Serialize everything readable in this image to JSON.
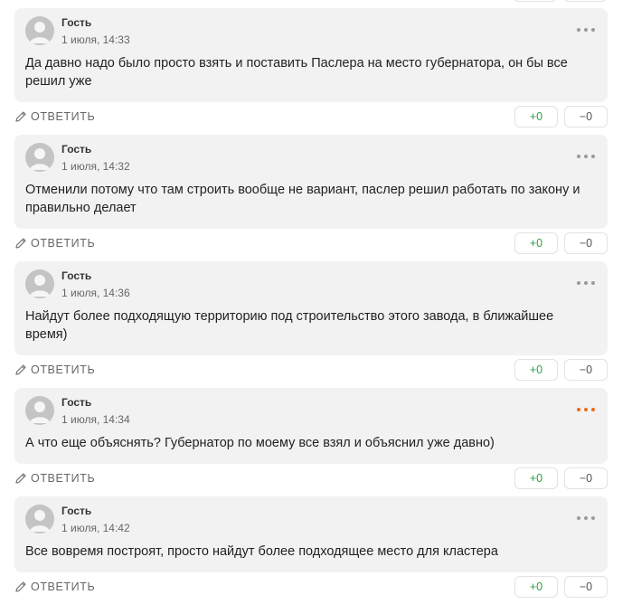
{
  "comments": [
    {
      "author": "Гость",
      "date": "1 июля, 14:33",
      "text": "Да давно надо было просто взять и поставить Паслера на место губернатора, он бы все решил уже",
      "reply_label": "ОТВЕТИТЬ",
      "likes": "+0",
      "dislikes": "−0",
      "menu_active": false
    },
    {
      "author": "Гость",
      "date": "1 июля, 14:32",
      "text": "Отменили потому что там строить вообще не вариант, паслер решил работать по закону и правильно делает",
      "reply_label": "ОТВЕТИТЬ",
      "likes": "+0",
      "dislikes": "−0",
      "menu_active": false
    },
    {
      "author": "Гость",
      "date": "1 июля, 14:36",
      "text": "Найдут более подходящую территорию под строительство этого завода, в ближайшее время)",
      "reply_label": "ОТВЕТИТЬ",
      "likes": "+0",
      "dislikes": "−0",
      "menu_active": false
    },
    {
      "author": "Гость",
      "date": "1 июля, 14:34",
      "text": "А что еще объяснять? Губернатор по моему все взял и объяснил уже давно)",
      "reply_label": "ОТВЕТИТЬ",
      "likes": "+0",
      "dislikes": "−0",
      "menu_active": true
    },
    {
      "author": "Гость",
      "date": "1 июля, 14:42",
      "text": "Все вовремя построят, просто найдут более подходящее место для кластера",
      "reply_label": "ОТВЕТИТЬ",
      "likes": "+0",
      "dislikes": "−0",
      "menu_active": false
    }
  ],
  "icons": {
    "avatar": "user-avatar-icon",
    "menu": "more-dots-icon",
    "reply": "pencil-icon"
  },
  "colors": {
    "card_background": "#f2f2f2",
    "like": "#2e9e44",
    "menu_active": "#f06a1d"
  }
}
